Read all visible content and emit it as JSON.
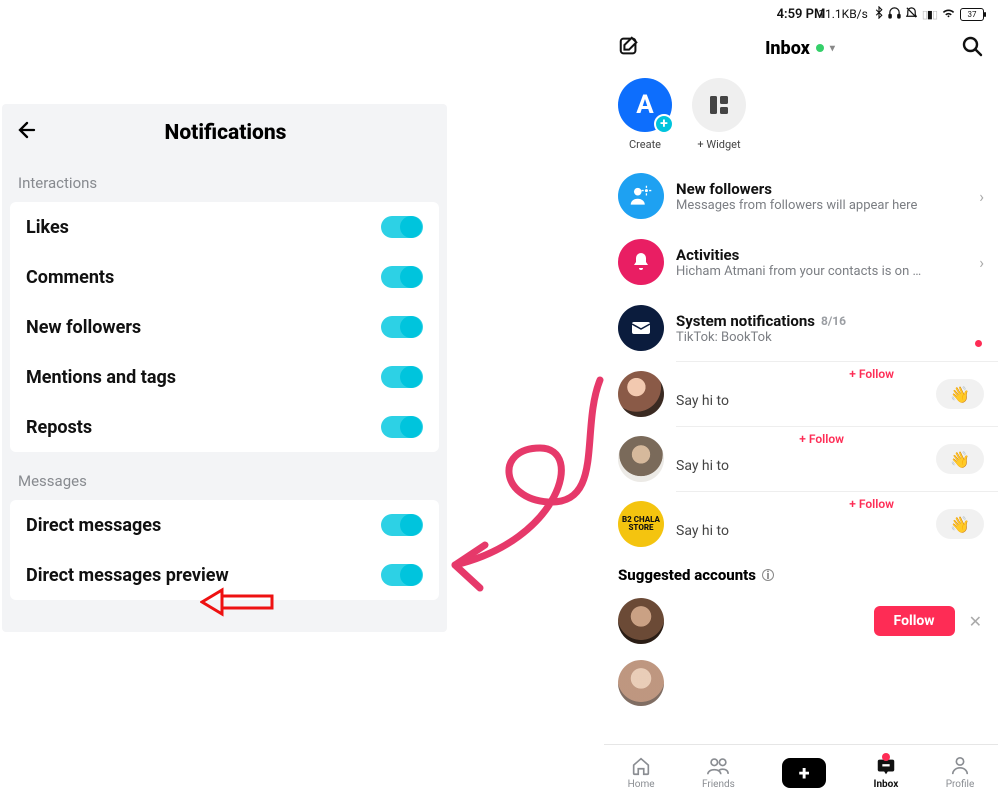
{
  "left": {
    "title": "Notifications",
    "section_interactions": "Interactions",
    "section_messages": "Messages",
    "rows_interactions": [
      "Likes",
      "Comments",
      "New followers",
      "Mentions and tags",
      "Reposts"
    ],
    "rows_messages": [
      "Direct messages",
      "Direct messages preview"
    ]
  },
  "right": {
    "status": {
      "time": "4:59 PM",
      "net": "11.1KB/s",
      "battery": "37"
    },
    "title": "Inbox",
    "quick": {
      "create": "Create",
      "widget": "+ Widget",
      "letter": "A"
    },
    "items": [
      {
        "title": "New followers",
        "sub": "Messages from followers will appear here"
      },
      {
        "title": "Activities",
        "sub": "Hicham Atmani from your contacts is on …"
      },
      {
        "title": "System notifications",
        "meta": "8/16",
        "sub": "TikTok: BookTok"
      }
    ],
    "dm_say": "Say hi to",
    "dm_follow": "+ Follow",
    "suggested_heading": "Suggested accounts",
    "follow_label": "Follow"
  },
  "tabs": {
    "home": "Home",
    "friends": "Friends",
    "inbox": "Inbox",
    "profile": "Profile"
  }
}
